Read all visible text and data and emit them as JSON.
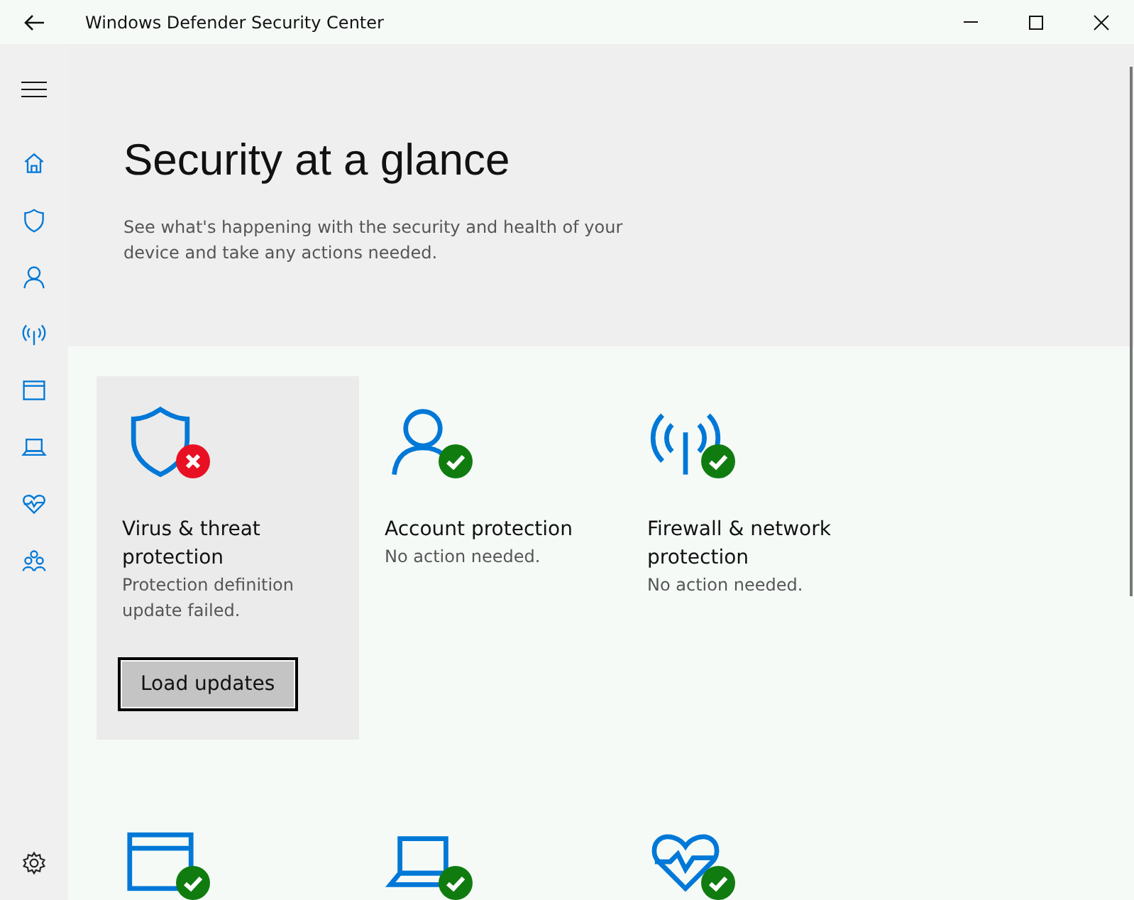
{
  "window": {
    "title": "Windows Defender Security Center"
  },
  "sidebar": {
    "items": [
      {
        "kind": "home"
      },
      {
        "kind": "shield"
      },
      {
        "kind": "person"
      },
      {
        "kind": "antenna"
      },
      {
        "kind": "browser"
      },
      {
        "kind": "laptop"
      },
      {
        "kind": "heart"
      },
      {
        "kind": "family"
      }
    ],
    "footer": {
      "kind": "settings"
    }
  },
  "header": {
    "title": "Security at a glance",
    "description": "See what's happening with the security and health of your device and take any actions needed."
  },
  "tiles": [
    {
      "kind": "shield",
      "failed": true,
      "highlighted": true,
      "title": "Virus & threat protection",
      "message": "Protection definition update failed.",
      "action": "Load updates"
    },
    {
      "kind": "person",
      "failed": false,
      "highlighted": false,
      "title": "Account protection",
      "message": "No action needed."
    },
    {
      "kind": "antenna",
      "failed": false,
      "highlighted": false,
      "title": "Firewall & network protection",
      "message": "No action needed."
    },
    {
      "kind": "browser",
      "failed": false,
      "highlighted": false
    },
    {
      "kind": "laptop",
      "failed": false,
      "highlighted": false
    },
    {
      "kind": "heart",
      "failed": false,
      "highlighted": false
    }
  ]
}
